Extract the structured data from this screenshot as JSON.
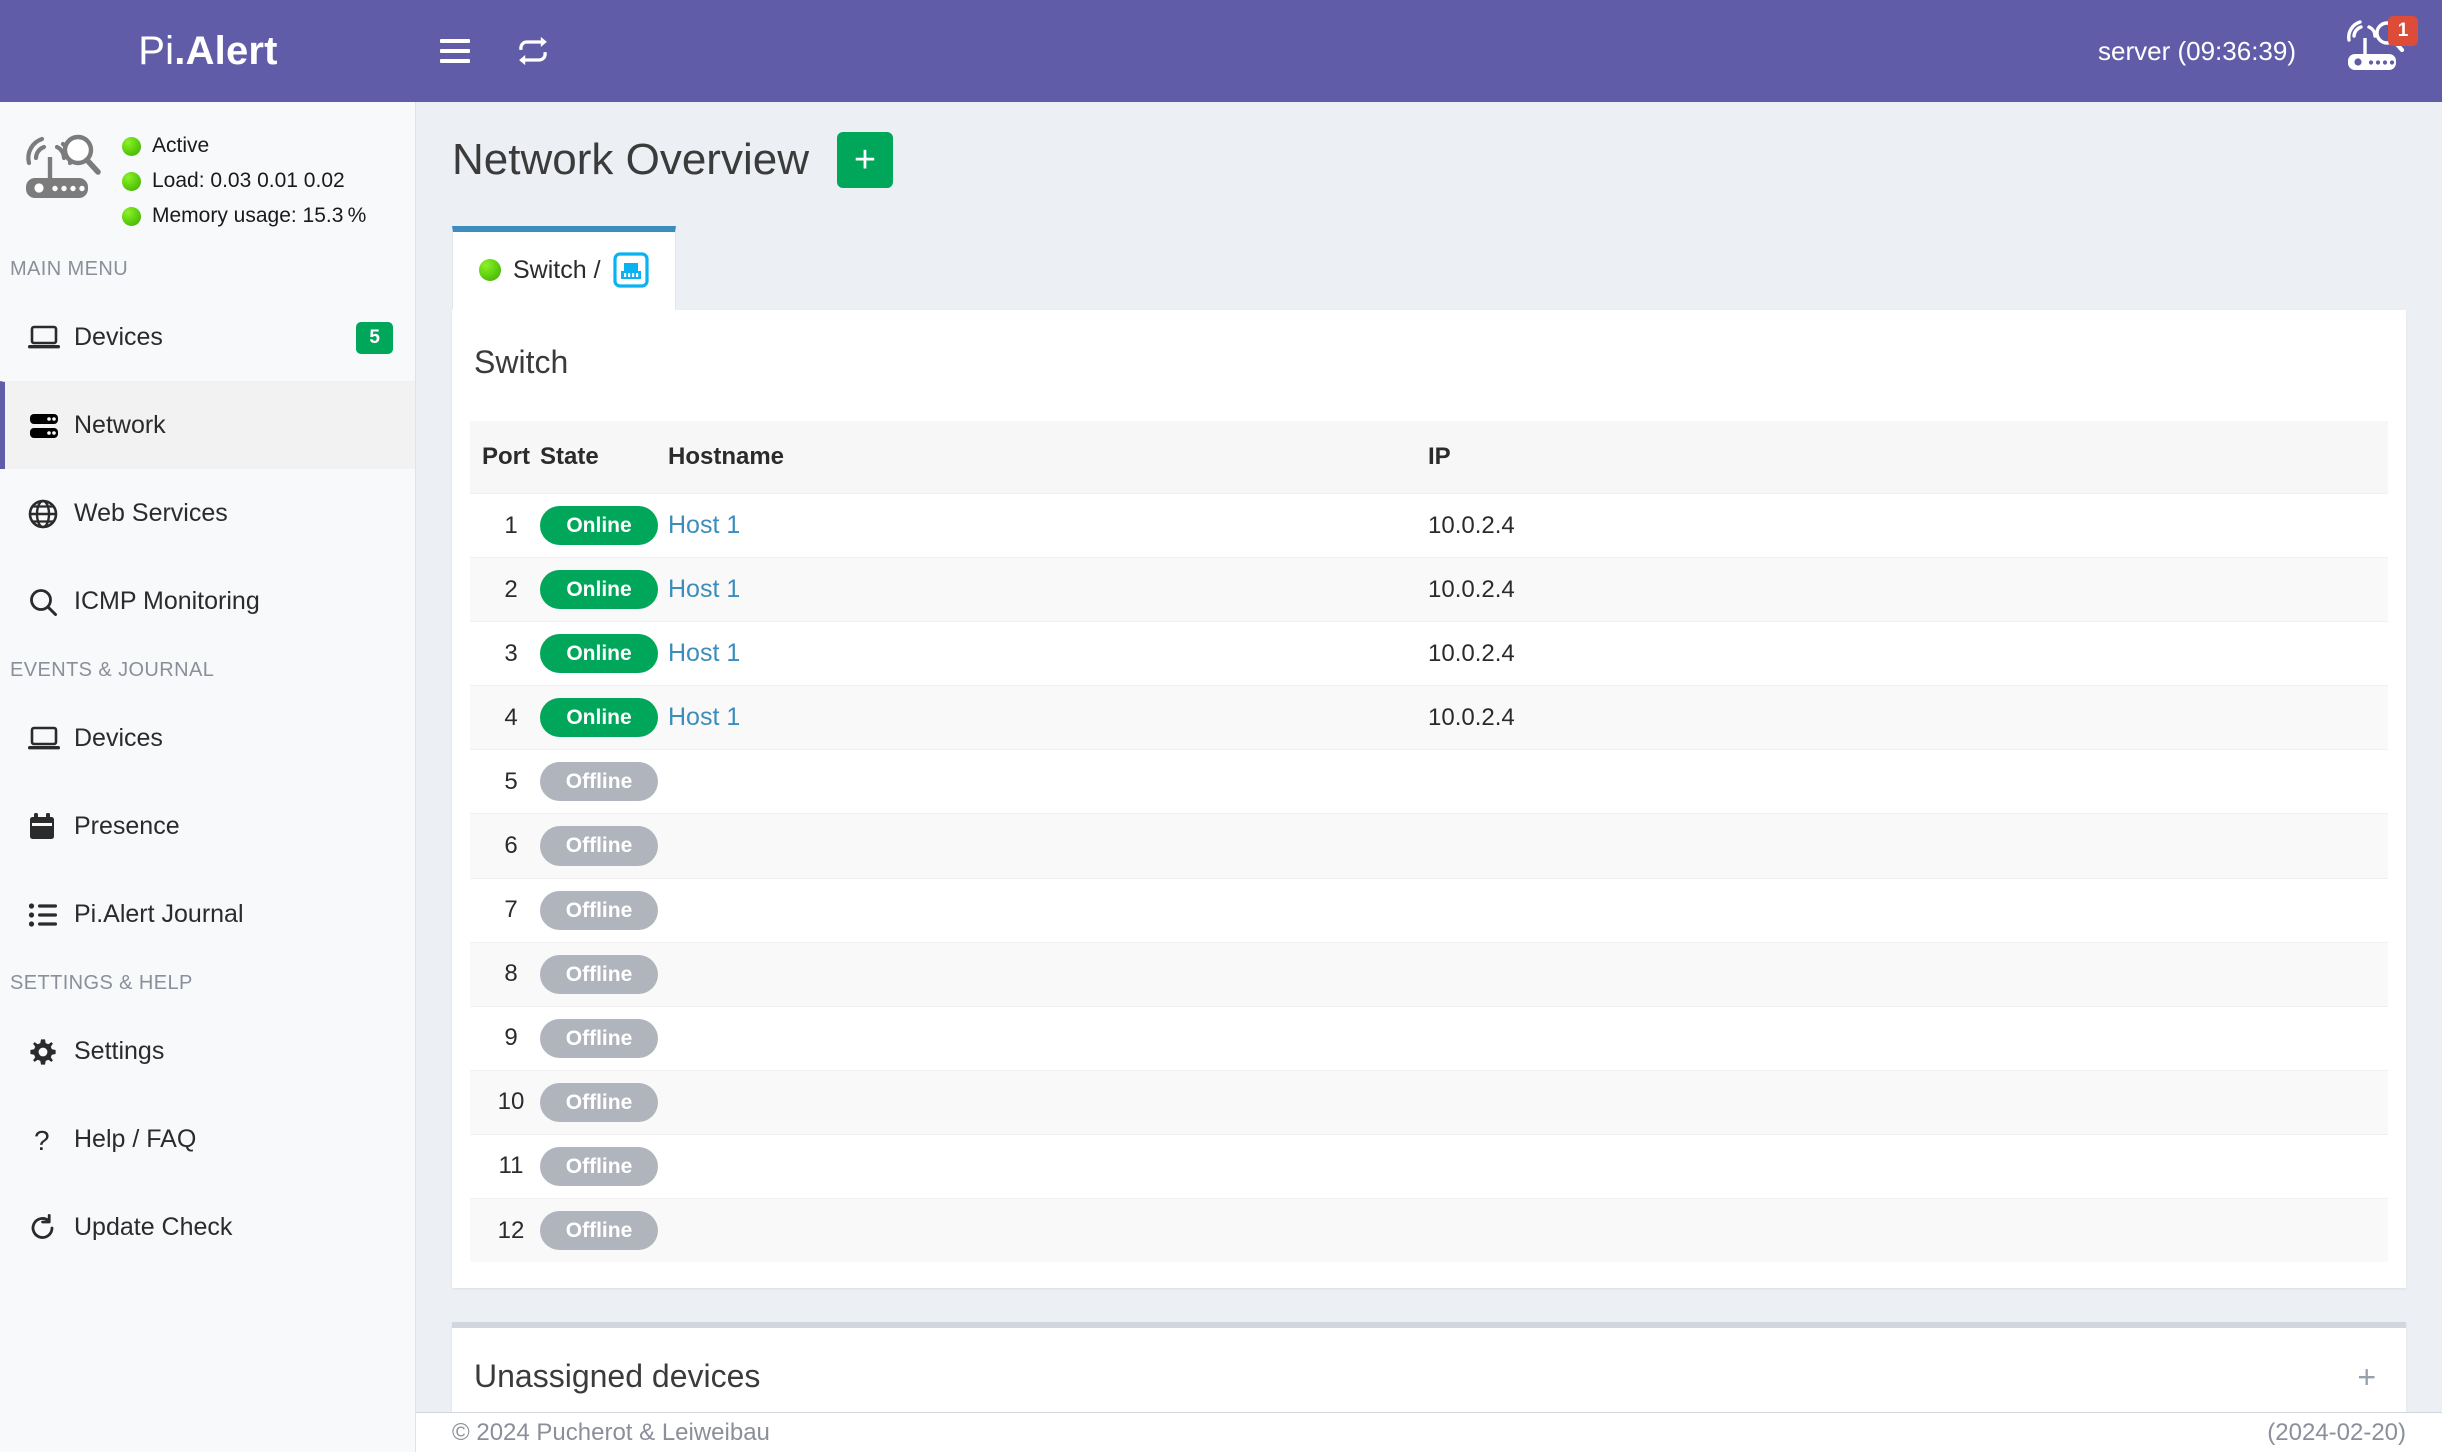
{
  "header": {
    "logo_light": "Pi",
    "logo_bold": ".Alert",
    "menu_icon": "hamburger-icon",
    "refresh_icon": "sync-icon",
    "server_label": "server (09:36:39)",
    "notification_icon": "pialert-router-icon",
    "notification_count": "1"
  },
  "sidebar": {
    "status_icon": "router-radar-icon",
    "status": [
      {
        "label": "Active",
        "color": "#63d411"
      },
      {
        "label": "Load:  0.03  0.01  0.02",
        "color": "#63d411"
      },
      {
        "label": "Memory usage:  15.3 %",
        "color": "#63d411"
      }
    ],
    "sections": [
      {
        "header": "MAIN MENU",
        "items": [
          {
            "label": "Devices",
            "icon": "laptop-icon",
            "badge": "5",
            "active": false
          },
          {
            "label": "Network",
            "icon": "server-rack-icon",
            "badge": "",
            "active": true
          },
          {
            "label": "Web Services",
            "icon": "globe-icon",
            "badge": "",
            "active": false
          },
          {
            "label": "ICMP Monitoring",
            "icon": "search-icon",
            "badge": "",
            "active": false
          }
        ]
      },
      {
        "header": "EVENTS & JOURNAL",
        "items": [
          {
            "label": "Devices",
            "icon": "laptop-icon",
            "badge": "",
            "active": false
          },
          {
            "label": "Presence",
            "icon": "calendar-icon",
            "badge": "",
            "active": false
          },
          {
            "label": "Pi.Alert Journal",
            "icon": "list-ul-icon",
            "badge": "",
            "active": false
          }
        ]
      },
      {
        "header": "SETTINGS & HELP",
        "items": [
          {
            "label": "Settings",
            "icon": "gear-icon",
            "badge": "",
            "active": false
          },
          {
            "label": "Help / FAQ",
            "icon": "question-icon",
            "badge": "",
            "active": false
          },
          {
            "label": "Update Check",
            "icon": "refresh-icon",
            "badge": "",
            "active": false
          }
        ]
      }
    ]
  },
  "main": {
    "page_title": "Network Overview",
    "add_button_label": "+",
    "tabs": [
      {
        "label": "Switch /",
        "status_color": "#63d411",
        "icon": "ethernet-port-icon",
        "active": true
      }
    ],
    "panel": {
      "title": "Switch",
      "columns": [
        "Port",
        "State",
        "Hostname",
        "IP"
      ],
      "rows": [
        {
          "port": "1",
          "state": "Online",
          "state_kind": "online",
          "hostname": "Host 1",
          "ip": "10.0.2.4"
        },
        {
          "port": "2",
          "state": "Online",
          "state_kind": "online",
          "hostname": "Host 1",
          "ip": "10.0.2.4"
        },
        {
          "port": "3",
          "state": "Online",
          "state_kind": "online",
          "hostname": "Host 1",
          "ip": "10.0.2.4"
        },
        {
          "port": "4",
          "state": "Online",
          "state_kind": "online",
          "hostname": "Host 1",
          "ip": "10.0.2.4"
        },
        {
          "port": "5",
          "state": "Offline",
          "state_kind": "offline",
          "hostname": "",
          "ip": ""
        },
        {
          "port": "6",
          "state": "Offline",
          "state_kind": "offline",
          "hostname": "",
          "ip": ""
        },
        {
          "port": "7",
          "state": "Offline",
          "state_kind": "offline",
          "hostname": "",
          "ip": ""
        },
        {
          "port": "8",
          "state": "Offline",
          "state_kind": "offline",
          "hostname": "",
          "ip": ""
        },
        {
          "port": "9",
          "state": "Offline",
          "state_kind": "offline",
          "hostname": "",
          "ip": ""
        },
        {
          "port": "10",
          "state": "Offline",
          "state_kind": "offline",
          "hostname": "",
          "ip": ""
        },
        {
          "port": "11",
          "state": "Offline",
          "state_kind": "offline",
          "hostname": "",
          "ip": ""
        },
        {
          "port": "12",
          "state": "Offline",
          "state_kind": "offline",
          "hostname": "",
          "ip": ""
        }
      ]
    },
    "unassigned": {
      "title": "Unassigned devices",
      "expand_label": "+"
    }
  },
  "footer": {
    "copyright": "© 2024 Pucherot & Leiweibau",
    "version": "(2024-02-20)"
  },
  "colors": {
    "brand_purple": "#605ca8",
    "online_green": "#00a65a",
    "offline_gray": "#b0b5bd",
    "link_blue": "#3c8dbc",
    "badge_red": "#dd4b39",
    "page_bg": "#eceff4"
  }
}
